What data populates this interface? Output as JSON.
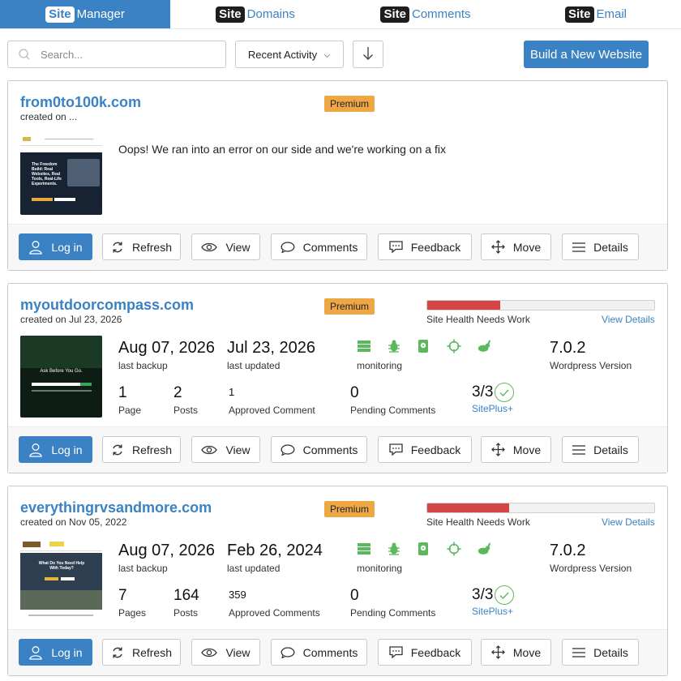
{
  "tabs": [
    {
      "badge": "Site",
      "label": "Manager",
      "active": true
    },
    {
      "badge": "Site",
      "label": "Domains",
      "active": false
    },
    {
      "badge": "Site",
      "label": "Comments",
      "active": false
    },
    {
      "badge": "Site",
      "label": "Email",
      "active": false
    }
  ],
  "toolbar": {
    "search_placeholder": "Search...",
    "sort_value": "Recent Activity",
    "build_label": "Build a New Website"
  },
  "labels": {
    "last_backup": "last backup",
    "last_updated": "last updated",
    "monitoring": "monitoring",
    "wp_version": "Wordpress Version",
    "health": "Site Health Needs Work",
    "view_details": "View Details",
    "sp_label": "SitePlus+",
    "premium": "Premium",
    "posts": "Posts",
    "approved": "Approved Comment",
    "approved_plural": "Approved Comments",
    "pending": "Pending Comments"
  },
  "actions": {
    "login": "Log in",
    "refresh": "Refresh",
    "view": "View",
    "comments": "Comments",
    "feedback": "Feedback",
    "move": "Move",
    "details": "Details"
  },
  "sites": [
    {
      "domain": "from0to100k.com",
      "created": "created on ...",
      "error": "Oops! We ran into an error on our side and we're working on a fix",
      "thumb_text": "The Freedom Build: Real Websites, Real Tools, Real-Life Experiments."
    },
    {
      "domain": "myoutdoorcompass.com",
      "created": "created on Jul 23, 2026",
      "health_fraction": 0.32,
      "backup": "Aug 07, 2026",
      "updated": "Jul 23, 2026",
      "wp_version": "7.0.2",
      "pages": "1",
      "pages_label": "Page",
      "posts": "2",
      "approved": "1",
      "pending": "0",
      "siteplus": "3/3",
      "thumb_text": "Ask Before You Go."
    },
    {
      "domain": "everythingrvsandmore.com",
      "created": "created on Nov 05, 2022",
      "health_fraction": 0.36,
      "backup": "Aug 07, 2026",
      "updated": "Feb 26, 2024",
      "wp_version": "7.0.2",
      "pages": "7",
      "pages_label": "Pages",
      "posts": "164",
      "approved": "359",
      "pending": "0",
      "siteplus": "3/3",
      "thumb_text": "What Do You Need Help With Today?"
    }
  ],
  "colors": {
    "accent": "#3a82c4",
    "premium": "#eea745",
    "health": "#d64545",
    "monitor": "#5cb85c"
  }
}
